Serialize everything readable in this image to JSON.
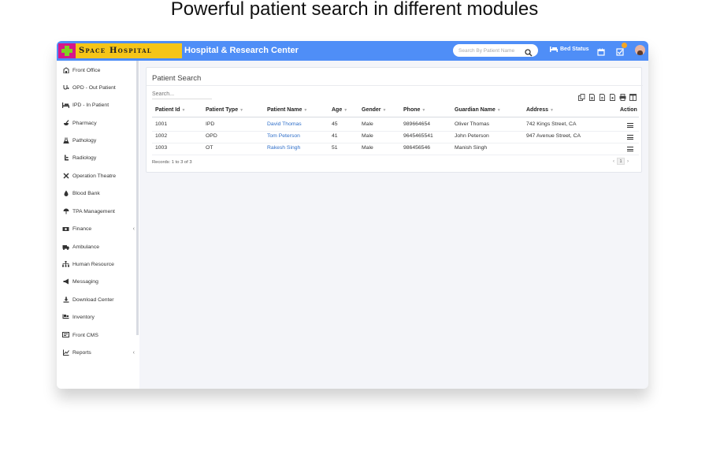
{
  "headline": "Powerful patient search in different modules",
  "header": {
    "logo_text": "Space Hospital",
    "title": "Hospital & Research Center",
    "search_placeholder": "Search By Patient Name",
    "bed_status": "Bed Status",
    "notification_count": "1"
  },
  "sidebar": {
    "items": [
      {
        "label": "Front Office",
        "icon": "building-icon"
      },
      {
        "label": "OPD - Out Patient",
        "icon": "stethoscope-icon"
      },
      {
        "label": "IPD - In Patient",
        "icon": "bed-icon"
      },
      {
        "label": "Pharmacy",
        "icon": "mortar-pestle-icon"
      },
      {
        "label": "Pathology",
        "icon": "flask-icon"
      },
      {
        "label": "Radiology",
        "icon": "xray-icon"
      },
      {
        "label": "Operation Theatre",
        "icon": "scissors-icon"
      },
      {
        "label": "Blood Bank",
        "icon": "blood-drop-icon"
      },
      {
        "label": "TPA Management",
        "icon": "umbrella-icon"
      },
      {
        "label": "Finance",
        "icon": "money-icon"
      },
      {
        "label": "Ambulance",
        "icon": "ambulance-icon"
      },
      {
        "label": "Human Resource",
        "icon": "sitemap-icon"
      },
      {
        "label": "Messaging",
        "icon": "bullhorn-icon"
      },
      {
        "label": "Download Center",
        "icon": "download-icon"
      },
      {
        "label": "Inventory",
        "icon": "inventory-icon"
      },
      {
        "label": "Front CMS",
        "icon": "cms-icon"
      },
      {
        "label": "Reports",
        "icon": "line-chart-icon"
      }
    ]
  },
  "panel": {
    "title": "Patient Search",
    "search_placeholder": "Search...",
    "columns": [
      "Patient Id",
      "Patient Type",
      "Patient Name",
      "Age",
      "Gender",
      "Phone",
      "Guardian Name",
      "Address",
      "Action"
    ],
    "rows": [
      {
        "id": "1001",
        "type": "IPD",
        "name": "David Thomas",
        "age": "45",
        "gender": "Male",
        "phone": "989664654",
        "guardian": "Oliver Thomas",
        "address": "742 Kings Street, CA"
      },
      {
        "id": "1002",
        "type": "OPD",
        "name": "Tom Peterson",
        "age": "41",
        "gender": "Male",
        "phone": "9645465541",
        "guardian": "John Peterson",
        "address": "947 Avenue Street, CA"
      },
      {
        "id": "1003",
        "type": "OT",
        "name": "Rakesh Singh",
        "age": "51",
        "gender": "Male",
        "phone": "986456546",
        "guardian": "Manish Singh",
        "address": ""
      }
    ],
    "records": "Records: 1 to 3 of 3",
    "page": "1"
  },
  "colors": {
    "topbar": "#4f8ef7",
    "logo_bg": "#f5c518",
    "link": "#2f6fc9",
    "badge": "#f5a623"
  }
}
